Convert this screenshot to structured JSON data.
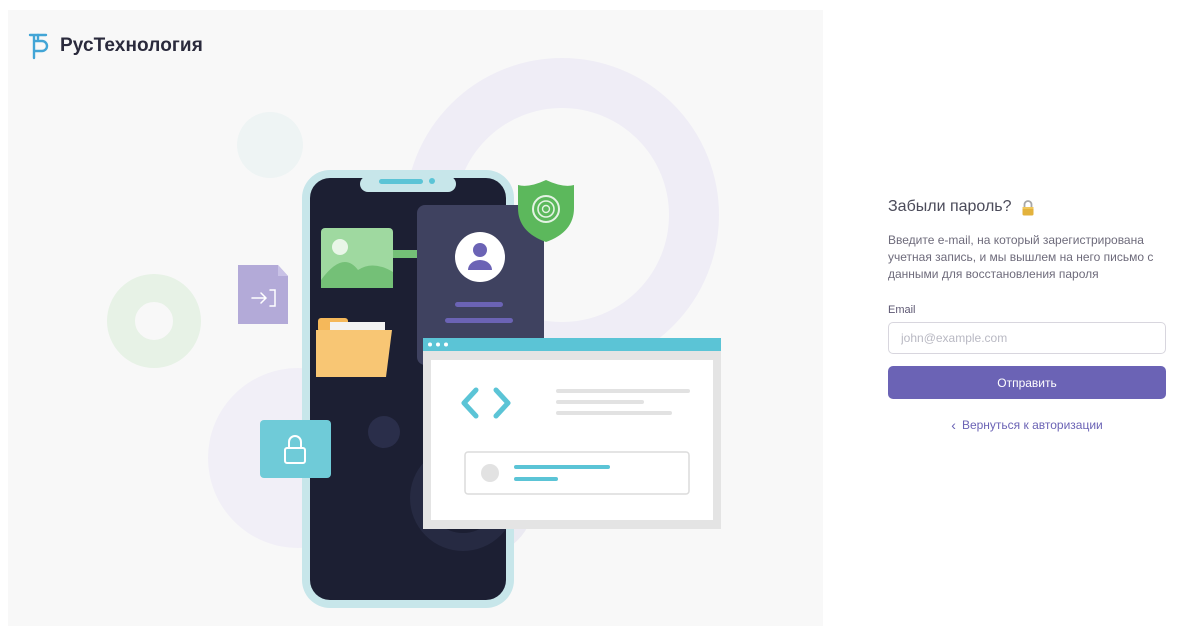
{
  "brand": {
    "name": "РусТехнология",
    "accent": "#42a5d6"
  },
  "forgot": {
    "title": "Забыли пароль?",
    "title_icon": "lock-icon",
    "description": "Введите e-mail, на который зарегистрирована учетная запись, и мы вышлем на него письмо с данными для восстановления пароля",
    "email_label": "Email",
    "email_placeholder": "john@example.com",
    "email_value": "",
    "submit_label": "Отправить",
    "back_chevron": "‹",
    "back_label": "Вернуться к авторизации"
  },
  "colors": {
    "primary": "#6b63b5",
    "panel_bg": "#f8f8f8",
    "phone_frame": "#c7e6ea",
    "phone_screen": "#1c1f33",
    "shield": "#5cb85c",
    "teal": "#5bc4d6"
  },
  "illustration_icons": [
    "login-file-icon",
    "image-icon",
    "folder-icon",
    "user-avatar-icon",
    "fingerprint-shield-icon",
    "code-window-icon",
    "padlock-icon"
  ]
}
